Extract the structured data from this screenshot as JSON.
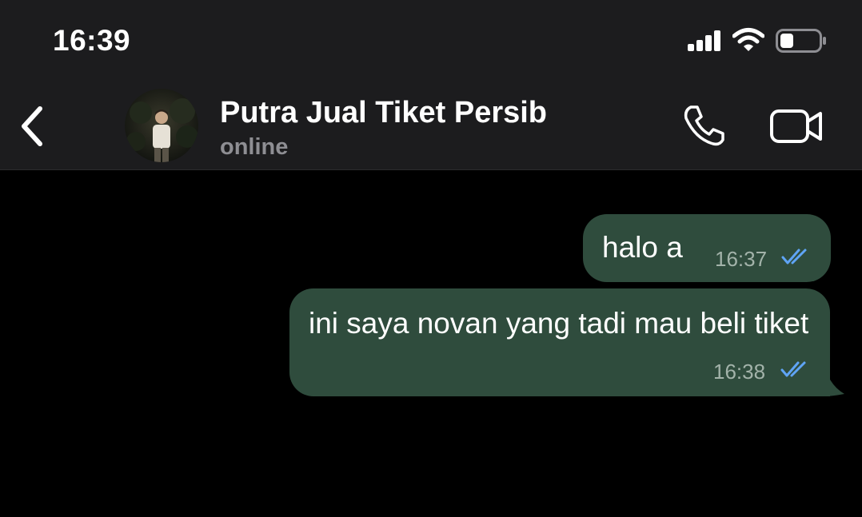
{
  "status_bar": {
    "time": "16:39",
    "icons": [
      "cellular-signal-icon",
      "wifi-icon",
      "battery-icon"
    ],
    "battery_level": 0.35
  },
  "header": {
    "contact_name": "Putra Jual Tiket Persib",
    "contact_status": "online",
    "icons": [
      "back-chevron-icon",
      "phone-icon",
      "video-camera-icon"
    ]
  },
  "messages": [
    {
      "text": "halo a",
      "time": "16:37",
      "direction": "outgoing",
      "status": "read"
    },
    {
      "text": "ini saya novan yang tadi mau beli tiket",
      "time": "16:38",
      "direction": "outgoing",
      "status": "read"
    }
  ],
  "colors": {
    "background": "#000000",
    "header": "#1c1c1e",
    "outgoing_bubble": "#2f4c3d",
    "read_ticks": "#5fa4f5",
    "secondary_text": "#8e8e93"
  }
}
